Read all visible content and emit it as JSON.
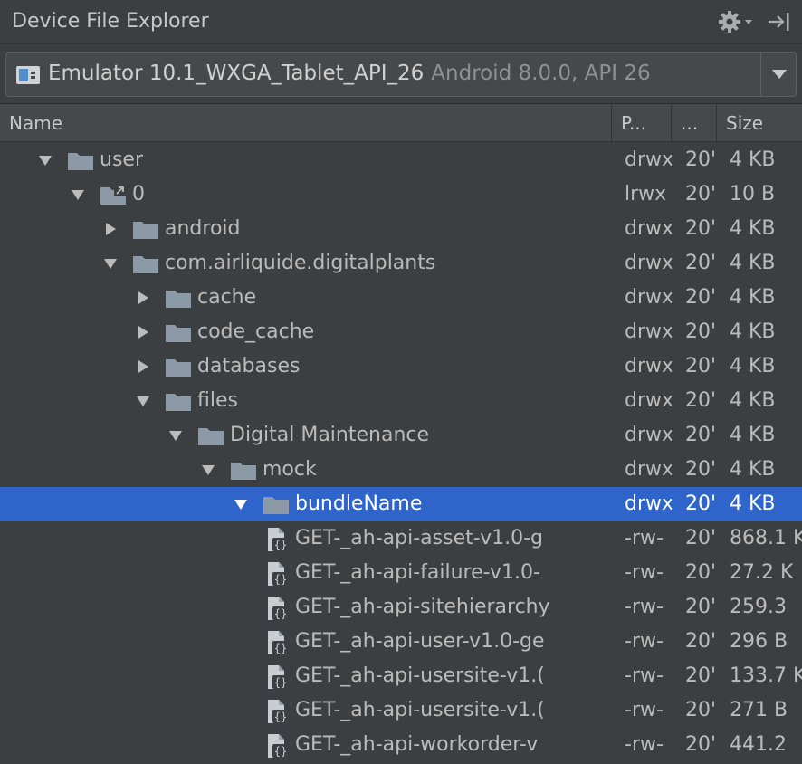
{
  "window": {
    "title": "Device File Explorer",
    "gear_icon": "gear-icon",
    "hide_icon": "hide-panel-icon"
  },
  "device": {
    "name": "Emulator 10.1_WXGA_Tablet_API_26",
    "detail": "Android 8.0.0, API 26",
    "icon": "emulator-device-icon"
  },
  "columns": {
    "name": "Name",
    "permissions": "P...",
    "date": "...",
    "size": "Size"
  },
  "colors": {
    "background": "#3c3f41",
    "selection": "#2f65ca",
    "folder": "#8c9aa8",
    "text": "#bbbbbb"
  },
  "rows": [
    {
      "level": 0,
      "arrow": "down",
      "type": "folder",
      "name": "user",
      "perm": "drwx",
      "date": "20'",
      "size": "4 KB",
      "selected": false
    },
    {
      "level": 1,
      "arrow": "down",
      "type": "link-folder",
      "name": "0",
      "perm": "lrwx",
      "date": "20'",
      "size": "10 B",
      "selected": false
    },
    {
      "level": 2,
      "arrow": "right",
      "type": "folder",
      "name": "android",
      "perm": "drwx",
      "date": "20'",
      "size": "4 KB",
      "selected": false
    },
    {
      "level": 2,
      "arrow": "down",
      "type": "folder",
      "name": "com.airliquide.digitalplants",
      "perm": "drwx",
      "date": "20'",
      "size": "4 KB",
      "selected": false
    },
    {
      "level": 3,
      "arrow": "right",
      "type": "folder",
      "name": "cache",
      "perm": "drwx",
      "date": "20'",
      "size": "4 KB",
      "selected": false
    },
    {
      "level": 3,
      "arrow": "right",
      "type": "folder",
      "name": "code_cache",
      "perm": "drwx",
      "date": "20'",
      "size": "4 KB",
      "selected": false
    },
    {
      "level": 3,
      "arrow": "right",
      "type": "folder",
      "name": "databases",
      "perm": "drwx",
      "date": "20'",
      "size": "4 KB",
      "selected": false
    },
    {
      "level": 3,
      "arrow": "down",
      "type": "folder",
      "name": "files",
      "perm": "drwx",
      "date": "20'",
      "size": "4 KB",
      "selected": false
    },
    {
      "level": 4,
      "arrow": "down",
      "type": "folder",
      "name": "Digital Maintenance",
      "perm": "drwx",
      "date": "20'",
      "size": "4 KB",
      "selected": false
    },
    {
      "level": 5,
      "arrow": "down",
      "type": "folder",
      "name": "mock",
      "perm": "drwx",
      "date": "20'",
      "size": "4 KB",
      "selected": false
    },
    {
      "level": 6,
      "arrow": "down",
      "type": "folder",
      "name": "bundleName",
      "perm": "drwx",
      "date": "20'",
      "size": "4 KB",
      "selected": true
    },
    {
      "level": 7,
      "arrow": "none",
      "type": "json-file",
      "name": "GET-_ah-api-asset-v1.0-g",
      "perm": "-rw-",
      "date": "20'",
      "size": "868.1 K",
      "selected": false
    },
    {
      "level": 7,
      "arrow": "none",
      "type": "json-file",
      "name": "GET-_ah-api-failure-v1.0-",
      "perm": "-rw-",
      "date": "20'",
      "size": "27.2 K",
      "selected": false
    },
    {
      "level": 7,
      "arrow": "none",
      "type": "json-file",
      "name": "GET-_ah-api-sitehierarchy",
      "perm": "-rw-",
      "date": "20'",
      "size": "259.3",
      "selected": false
    },
    {
      "level": 7,
      "arrow": "none",
      "type": "json-file",
      "name": "GET-_ah-api-user-v1.0-ge",
      "perm": "-rw-",
      "date": "20'",
      "size": "296 B",
      "selected": false
    },
    {
      "level": 7,
      "arrow": "none",
      "type": "json-file",
      "name": "GET-_ah-api-usersite-v1.(",
      "perm": "-rw-",
      "date": "20'",
      "size": "133.7 K",
      "selected": false
    },
    {
      "level": 7,
      "arrow": "none",
      "type": "json-file",
      "name": "GET-_ah-api-usersite-v1.(",
      "perm": "-rw-",
      "date": "20'",
      "size": "271 B",
      "selected": false
    },
    {
      "level": 7,
      "arrow": "none",
      "type": "json-file",
      "name": "GET-_ah-api-workorder-v",
      "perm": "-rw-",
      "date": "20'",
      "size": "441.2",
      "selected": false
    }
  ]
}
